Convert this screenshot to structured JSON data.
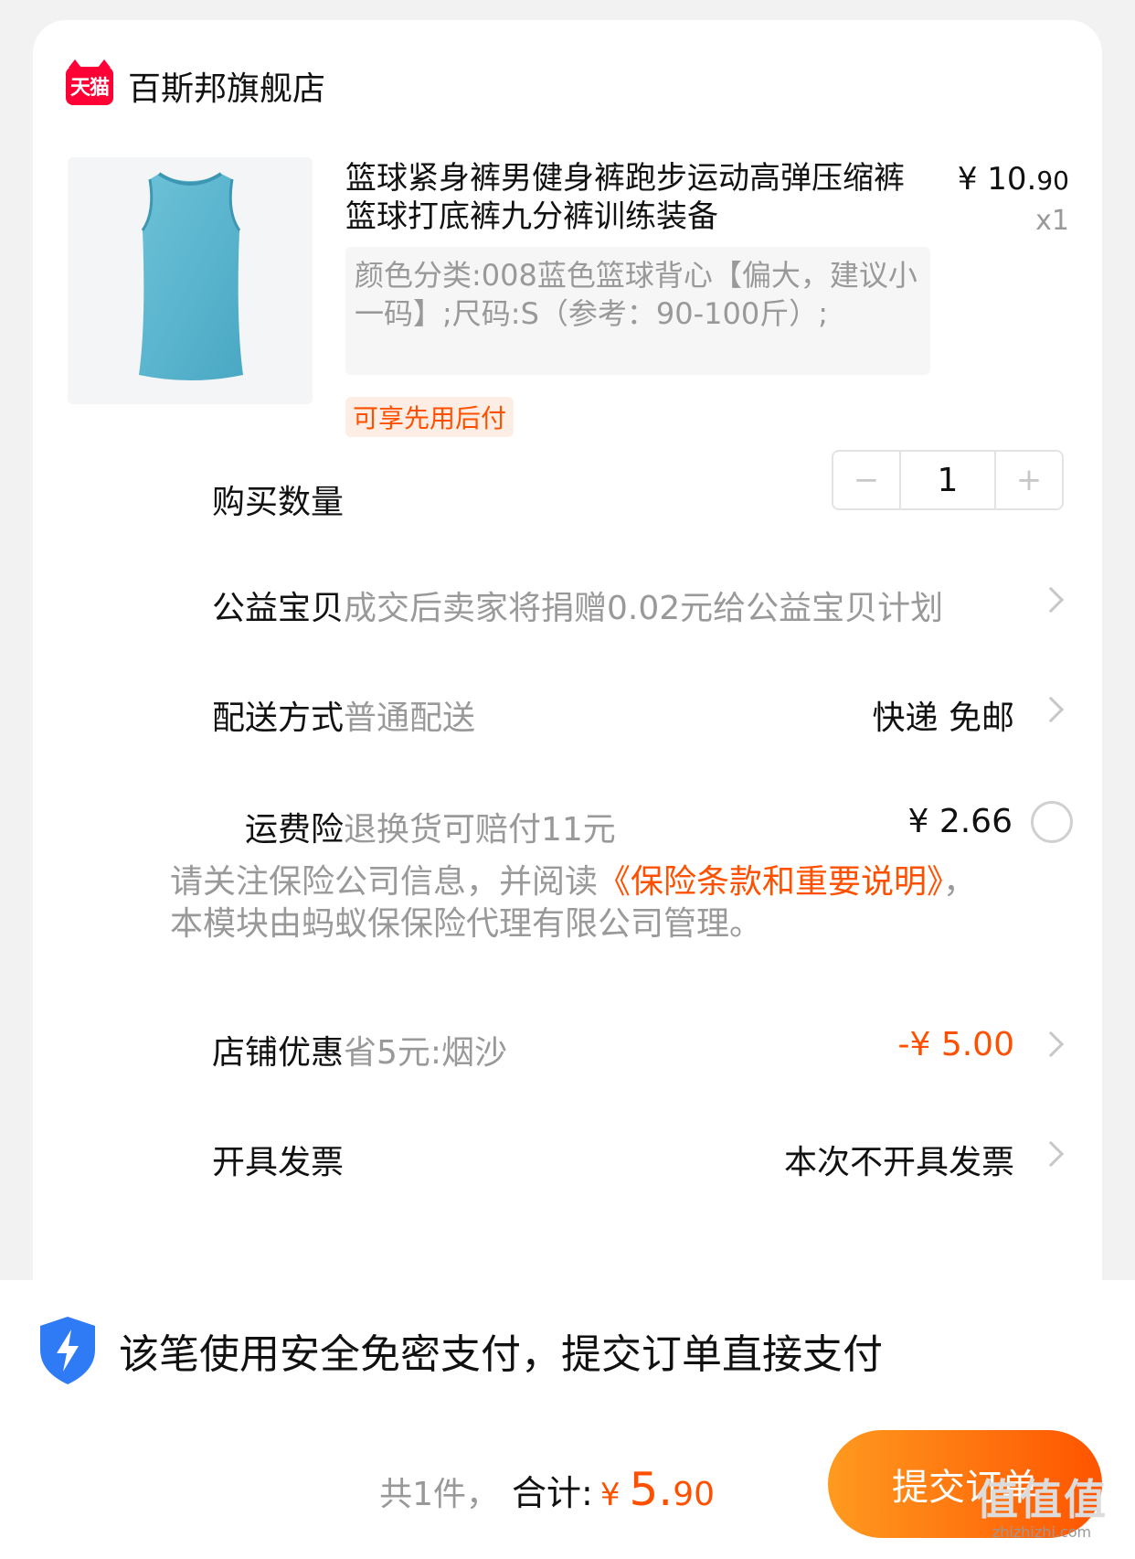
{
  "store": {
    "logo_text": "天猫",
    "name": "百斯邦旗舰店"
  },
  "product": {
    "title": "篮球紧身裤男健身裤跑步运动高弹压缩裤篮球打底裤九分裤训练装备",
    "price_int": "¥ 10.",
    "price_dec": "90",
    "quantity_label": "x1",
    "spec": "颜色分类:008蓝色篮球背心【偏大，建议小一码】;尺码:S（参考：90-100斤）;",
    "tag": "可享先用后付"
  },
  "quantity": {
    "label": "购买数量",
    "value": "1",
    "minus": "−",
    "plus": "+"
  },
  "charity": {
    "label": "公益宝贝",
    "desc": "成交后卖家将捐赠0.02元给公益宝贝计划"
  },
  "delivery": {
    "label": "配送方式",
    "desc": "普通配送",
    "value": "快递 免邮"
  },
  "insurance": {
    "label": "运费险",
    "desc": "退换货可赔付11元",
    "value": "¥ 2.66"
  },
  "notice": {
    "pre": "请关注保险公司信息，并阅读",
    "link": "《保险条款和重要说明》",
    "post": "，本模块由蚂蚁保保险代理有限公司管理。"
  },
  "discount": {
    "label": "店铺优惠",
    "desc": "省5元:烟沙",
    "value": "-¥ 5.00"
  },
  "invoice": {
    "label": "开具发票",
    "value": "本次不开具发票"
  },
  "secure_pay": {
    "text": "该笔使用安全免密支付，提交订单直接支付"
  },
  "summary": {
    "count": "共1件，",
    "total_label": "合计:",
    "yen": "¥",
    "amount_int": "5.",
    "amount_dec": "90"
  },
  "submit_button": "提交订单",
  "watermark": {
    "main": "值值值",
    "sub": "zhizhizhi.com"
  },
  "colors": {
    "accent": "#ff5000",
    "tmall_red": "#ff0036",
    "shirt_blue": "#5bb6cf"
  }
}
